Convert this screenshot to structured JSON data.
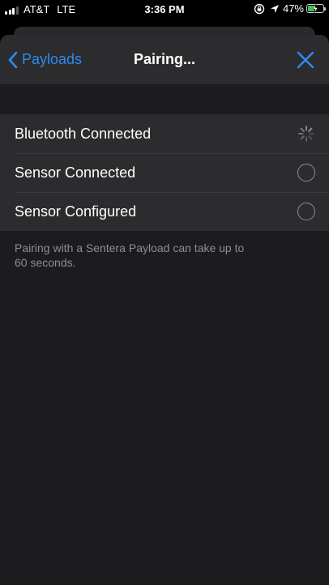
{
  "status_bar": {
    "carrier": "AT&T",
    "network": "LTE",
    "time": "3:36 PM",
    "battery_percent": "47%",
    "battery_level": 0.47,
    "battery_color": "#34c759",
    "icons": [
      "signal-bars-icon",
      "orientation-lock-icon",
      "location-arrow-icon",
      "battery-charging-icon"
    ]
  },
  "nav": {
    "back_label": "Payloads",
    "title": "Pairing...",
    "accent_color": "#2d8cf0",
    "close_icon": "close-icon"
  },
  "steps": [
    {
      "label": "Bluetooth Connected",
      "state": "in-progress",
      "icon": "spinner-icon"
    },
    {
      "label": "Sensor Connected",
      "state": "pending",
      "icon": "empty-circle-icon"
    },
    {
      "label": "Sensor Configured",
      "state": "pending",
      "icon": "empty-circle-icon"
    }
  ],
  "footer_note": "Pairing with a Sentera Payload can take up to 60 seconds."
}
